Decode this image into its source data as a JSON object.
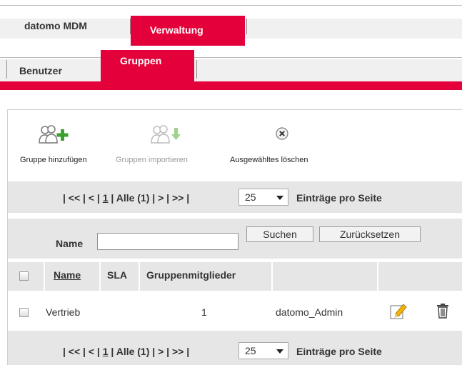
{
  "top_tabs": [
    {
      "label": "datomo MDM",
      "active": false
    },
    {
      "label": "Verwaltung",
      "active": true
    }
  ],
  "sub_tabs": [
    {
      "label": "Benutzer",
      "active": false
    },
    {
      "label": "Gruppen",
      "active": true
    }
  ],
  "toolbar": {
    "add_label": "Gruppe hinzufügen",
    "import_label": "Gruppen importieren",
    "delete_label": "Ausgewähltes löschen"
  },
  "pager_top": {
    "prefix": "| << | < | ",
    "current": "1",
    "suffix": " | Alle (1) | > | >> |",
    "per_page": "25",
    "per_page_label": "Einträge pro Seite"
  },
  "pager_bottom": {
    "prefix": "| << | < | ",
    "current": "1",
    "suffix": " | Alle (1) | > | >> |",
    "per_page": "25",
    "per_page_label": "Einträge pro Seite"
  },
  "search": {
    "label": "Name",
    "value": "",
    "search_button": "Suchen",
    "reset_button": "Zurücksetzen"
  },
  "table": {
    "columns": [
      "Name",
      "SLA",
      "Gruppenmitglieder"
    ],
    "rows": [
      {
        "name": "Vertrieb",
        "sla": "",
        "members": "1",
        "owner": "datomo_Admin"
      }
    ]
  },
  "colors": {
    "accent": "#e4003a",
    "bar": "#e6e6e6"
  }
}
